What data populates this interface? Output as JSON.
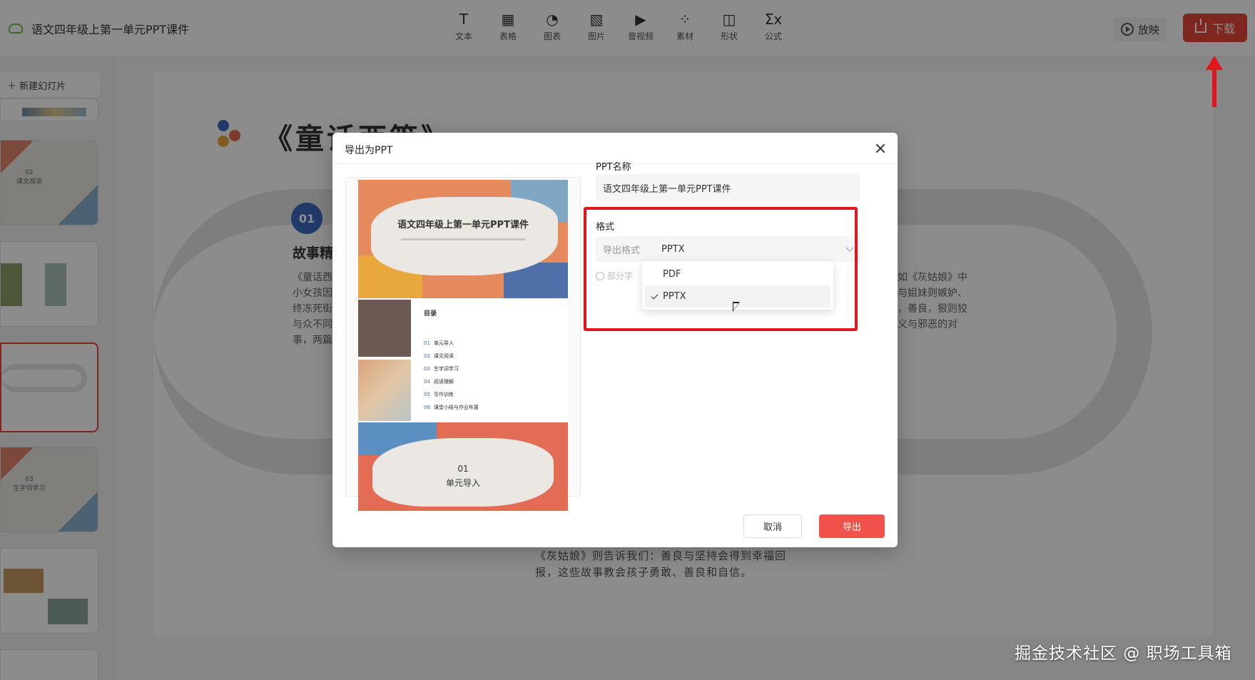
{
  "header": {
    "doc_title": "语文四年级上第一单元PPT课件",
    "tools": [
      {
        "icon": "T",
        "label": "文本"
      },
      {
        "icon": "▦",
        "label": "表格"
      },
      {
        "icon": "◔",
        "label": "图表"
      },
      {
        "icon": "▧",
        "label": "图片"
      },
      {
        "icon": "▶",
        "label": "音视频"
      },
      {
        "icon": "⁘",
        "label": "素材"
      },
      {
        "icon": "◫",
        "label": "形状"
      },
      {
        "icon": "Σx",
        "label": "公式"
      }
    ],
    "play_label": "放映",
    "download_label": "下载"
  },
  "sidebar": {
    "new_slide_label": "新建幻灯片",
    "thumbs": [
      {
        "num": "02",
        "label": "课文阅读"
      },
      {
        "num": "03",
        "label": "生字词学习"
      }
    ]
  },
  "slide": {
    "title": "《童话西篇》",
    "section_num": "01",
    "section_head": "故事精",
    "left_text": [
      "《童话西",
      "小女孩因",
      "终冻死街",
      "与众不同",
      "事，两篇"
    ],
    "right_text": [
      "如《灰姑娘》中",
      "与姐妹则嫉妒、",
      "，善良，狠则狡",
      "义与邪恶的对"
    ],
    "bottom_caption": [
      "《灰姑娘》则告诉我们：善良与坚持会得到幸福回",
      "报，这些故事教会孩子勇敢、善良和自信。"
    ]
  },
  "dialog": {
    "title": "导出为PPT",
    "name_label": "PPT名称",
    "name_value": "语文四年级上第一单元PPT课件",
    "format_label": "格式",
    "format_key": "导出格式",
    "format_value": "PPTX",
    "partial_label": "部分字",
    "options": [
      "PDF",
      "PPTX"
    ],
    "selected_option": "PPTX",
    "cancel_label": "取消",
    "export_label": "导出",
    "preview": {
      "cover_title": "语文四年级上第一单元PPT课件",
      "toc_title": "目录",
      "toc_items": [
        {
          "num": "01",
          "text": "单元导入"
        },
        {
          "num": "02",
          "text": "课文阅读"
        },
        {
          "num": "03",
          "text": "生字词学习"
        },
        {
          "num": "04",
          "text": "阅读理解"
        },
        {
          "num": "05",
          "text": "写作训练"
        },
        {
          "num": "06",
          "text": "课堂小结与作业布置"
        }
      ],
      "section_num": "01",
      "section_label": "单元导入"
    }
  },
  "watermark": "掘金技术社区 @ 职场工具箱",
  "colors": {
    "accent": "#e8453c",
    "annotation": "#e3141c",
    "export_btn": "#f0514a"
  }
}
